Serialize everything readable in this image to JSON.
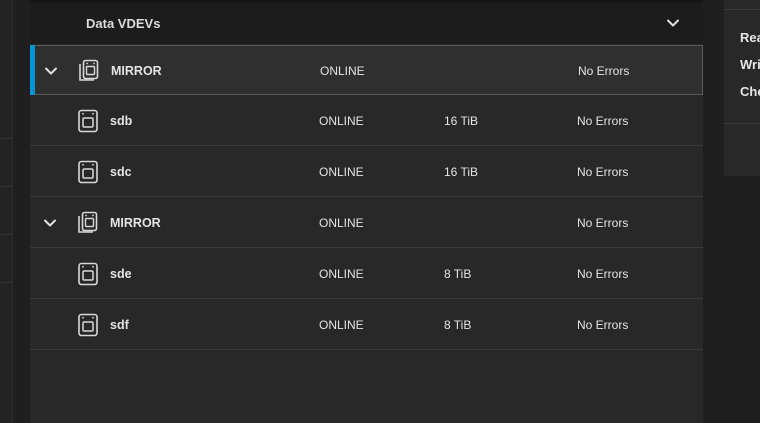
{
  "panel": {
    "title": "Data VDEVs",
    "rows": [
      {
        "type": "mirror",
        "name": "MIRROR",
        "status": "ONLINE",
        "size": "",
        "errors": "No Errors",
        "selected": true
      },
      {
        "type": "disk",
        "name": "sdb",
        "status": "ONLINE",
        "size": "16 TiB",
        "errors": "No Errors"
      },
      {
        "type": "disk",
        "name": "sdc",
        "status": "ONLINE",
        "size": "16 TiB",
        "errors": "No Errors"
      },
      {
        "type": "mirror",
        "name": "MIRROR",
        "status": "ONLINE",
        "size": "",
        "errors": "No Errors"
      },
      {
        "type": "disk",
        "name": "sde",
        "status": "ONLINE",
        "size": "8 TiB",
        "errors": "No Errors"
      },
      {
        "type": "disk",
        "name": "sdf",
        "status": "ONLINE",
        "size": "8 TiB",
        "errors": "No Errors"
      }
    ]
  },
  "side_card": {
    "labels": [
      "Rea",
      "Wri",
      "Che"
    ]
  },
  "colors": {
    "accent": "#0095d5",
    "background": "#1f1f1f",
    "panel": "#282828"
  },
  "icons": {
    "expand": "chevron-down-icon",
    "mirror": "mirror-vdev-icon",
    "disk": "disk-icon"
  }
}
